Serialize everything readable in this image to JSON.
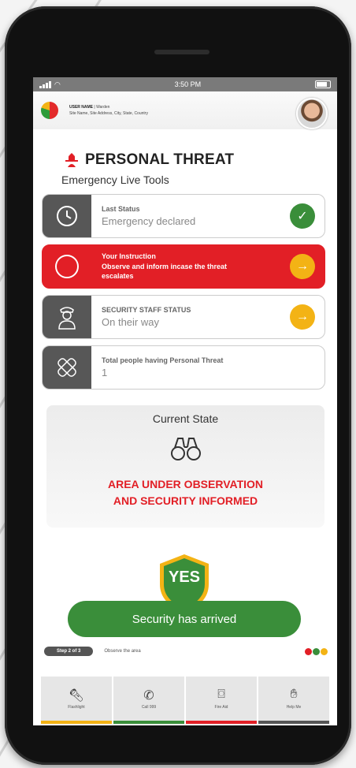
{
  "status_bar": {
    "time": "3:50 PM"
  },
  "header": {
    "user_name": "USER NAME",
    "user_role": "Warden",
    "site_line": "Site Name, Site Address, City, State, Country"
  },
  "page": {
    "title": "PERSONAL THREAT",
    "subtitle": "Emergency Live Tools"
  },
  "cards": [
    {
      "label": "Last Status",
      "value": "Emergency declared",
      "icon": "clock-icon",
      "action_icon": "check-icon"
    },
    {
      "label": "Your Instruction",
      "value": "Observe and inform incase the threat escalates",
      "icon": "circle-icon",
      "action_icon": "arrow-right-icon"
    },
    {
      "label": "SECURITY STAFF STATUS",
      "value": "On their way",
      "icon": "security-guard-icon",
      "action_icon": "arrow-right-icon"
    },
    {
      "label": "Total people having Personal Threat",
      "value": "1",
      "icon": "bandage-icon"
    }
  ],
  "current_state": {
    "label": "Current State",
    "message_line1": "AREA UNDER OBSERVATION",
    "message_line2": "AND SECURITY INFORMED",
    "icon": "binoculars-icon"
  },
  "confirmation": {
    "badge": "YES",
    "button": "Security has arrived"
  },
  "step": {
    "badge": "Step 2 of 3",
    "text": "Observe the area",
    "dot_colors": [
      "#e21f26",
      "#3a8e3a",
      "#f3b315"
    ]
  },
  "bottom_nav": [
    {
      "label": "Flashlight",
      "icon": "flashlight-icon",
      "color": "#f3b315"
    },
    {
      "label": "Call 999",
      "icon": "phone-icon",
      "color": "#3a8e3a"
    },
    {
      "label": "Fire Aid",
      "icon": "camera-icon",
      "color": "#e21f26"
    },
    {
      "label": "Help Me",
      "icon": "hand-icon",
      "color": "#555555"
    }
  ],
  "colors": {
    "red": "#e21f26",
    "green": "#3a8e3a",
    "yellow": "#f3b315",
    "gray": "#575757"
  }
}
